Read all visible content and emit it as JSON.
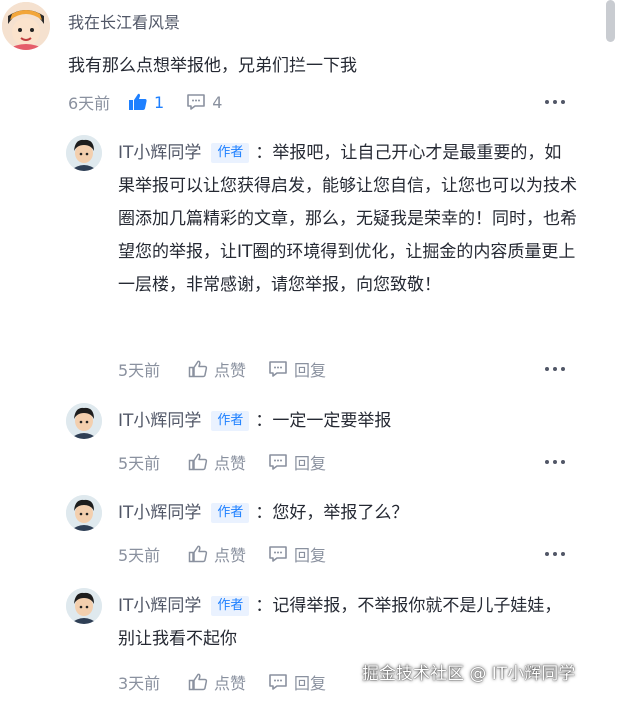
{
  "main_comment": {
    "user_name": "我在长江看风景",
    "text": "我有那么点想举报他，兄弟们拦一下我",
    "time": "6天前",
    "like_count": "1",
    "reply_count": "4"
  },
  "replies": [
    {
      "user_name": "IT小辉同学",
      "badge": "作者",
      "text": "：举报吧，让自己开心才是最重要的，如果举报可以让您获得启发，能够让您自信，让您也可以为技术圈添加几篇精彩的文章，那么，无疑我是荣幸的！同时，也希望您的举报，让IT圈的环境得到优化，让掘金的内容质量更上一层楼，非常感谢，请您举报，向您致敬！",
      "time": "5天前",
      "like_label": "点赞",
      "reply_label": "回复"
    },
    {
      "user_name": "IT小辉同学",
      "badge": "作者",
      "text": "：一定一定要举报",
      "time": "5天前",
      "like_label": "点赞",
      "reply_label": "回复"
    },
    {
      "user_name": "IT小辉同学",
      "badge": "作者",
      "text": "：您好，举报了么？",
      "time": "5天前",
      "like_label": "点赞",
      "reply_label": "回复"
    },
    {
      "user_name": "IT小辉同学",
      "badge": "作者",
      "text": "：记得举报，不举报你就不是儿子娃娃，别让我看不起你",
      "time": "3天前",
      "like_label": "点赞",
      "reply_label": "回复"
    }
  ],
  "watermark": "掘金技术社区 @ IT小辉同学",
  "colors": {
    "accent": "#1e80ff",
    "muted": "#8a919f",
    "text": "#252933"
  }
}
